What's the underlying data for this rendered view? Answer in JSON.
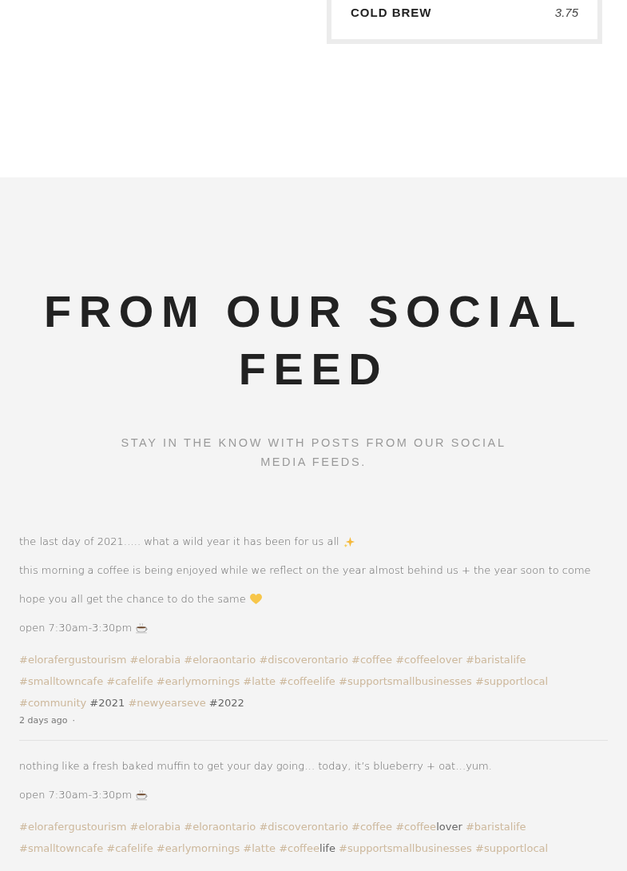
{
  "menu_card": {
    "items": [
      {
        "name": "COLD BREW",
        "price": "3.75"
      }
    ]
  },
  "social": {
    "title": "FROM OUR SOCIAL FEED",
    "subtitle": "STAY IN THE KNOW WITH POSTS FROM OUR SOCIAL MEDIA FEEDS.",
    "posts": [
      {
        "paragraphs": [
          {
            "text": "the last day of 2021….. what a wild year it has been for us all",
            "kind": "sparkle"
          },
          {
            "text": "this morning a coffee is being enjoyed while we reflect on the year almost behind us + the year soon to come"
          },
          {
            "text": "hope you all get the chance to do the same",
            "kind": "heart"
          },
          {
            "text": "open 7:30am-3:30pm",
            "kind": "coffee"
          }
        ],
        "tags": [
          [
            {
              "text": "#elorafergustourism",
              "link": true
            }
          ],
          [
            {
              "text": "#elorabia",
              "link": true
            }
          ],
          [
            {
              "text": "#eloraontario",
              "link": true
            }
          ],
          [
            {
              "text": "#discoverontario",
              "link": true
            }
          ],
          [
            {
              "text": "#coffee",
              "link": true
            }
          ],
          [
            {
              "text": "#coffeelover",
              "link": true
            }
          ],
          [
            {
              "text": "#baristalife",
              "link": true
            }
          ],
          [
            {
              "text": "#smalltowncafe",
              "link": true
            }
          ],
          [
            {
              "text": "#cafelife",
              "link": true
            }
          ],
          [
            {
              "text": "#earlymornings",
              "link": true
            }
          ],
          [
            {
              "text": "#latte",
              "link": true
            }
          ],
          [
            {
              "text": "#coffeelife",
              "link": true
            }
          ],
          [
            {
              "text": "#supportsmallbusinesses",
              "link": true
            }
          ],
          [
            {
              "text": "#supportlocal",
              "link": true
            }
          ],
          [
            {
              "text": "#community",
              "link": true
            }
          ],
          [
            {
              "text": "#2021",
              "link": false
            }
          ],
          [
            {
              "text": "#newyearseve",
              "link": true
            }
          ],
          [
            {
              "text": "#2022",
              "link": false
            }
          ]
        ],
        "time": "2 days ago",
        "separator": "·"
      },
      {
        "paragraphs": [
          {
            "text": "nothing like a fresh baked muffin to get your day going… today, it’s blueberry + oat…yum."
          },
          {
            "text": "open 7:30am-3:30pm",
            "kind": "coffee"
          }
        ],
        "tags": [
          [
            {
              "text": "#elorafergustourism",
              "link": true
            }
          ],
          [
            {
              "text": "#elorabia",
              "link": true
            }
          ],
          [
            {
              "text": "#eloraontario",
              "link": true
            }
          ],
          [
            {
              "text": "#discoverontario",
              "link": true
            }
          ],
          [
            {
              "text": "#coffee",
              "link": true
            }
          ],
          [
            {
              "text": "#coffee",
              "link": true
            },
            {
              "text": "lover",
              "link": false
            }
          ],
          [
            {
              "text": "#baristalife",
              "link": true
            }
          ],
          [
            {
              "text": "#smalltowncafe",
              "link": true
            }
          ],
          [
            {
              "text": "#cafelife",
              "link": true
            }
          ],
          [
            {
              "text": "#earlymornings",
              "link": true
            }
          ],
          [
            {
              "text": "#latte",
              "link": true
            }
          ],
          [
            {
              "text": "#coffee",
              "link": true
            },
            {
              "text": "life",
              "link": false
            }
          ],
          [
            {
              "text": "#supportsmallbusinesses",
              "link": true
            }
          ],
          [
            {
              "text": "#supportlocal",
              "link": true
            }
          ]
        ]
      }
    ]
  }
}
